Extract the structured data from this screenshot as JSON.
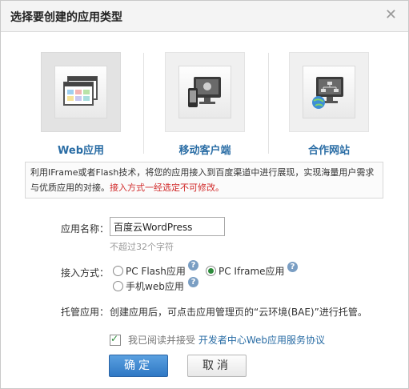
{
  "dialog": {
    "title": "选择要创建的应用类型",
    "close_glyph": "✕"
  },
  "types": [
    {
      "label": "Web应用",
      "icon": "browser-window-icon",
      "selected": true
    },
    {
      "label": "移动客户端",
      "icon": "mobile-device-icon",
      "selected": false
    },
    {
      "label": "合作网站",
      "icon": "network-site-icon",
      "selected": false
    }
  ],
  "info": {
    "text": "利用IFrame或者Flash技术，将您的应用接入到百度渠道中进行展现，实现海量用户需求与优质应用的对接。",
    "warning": "接入方式一经选定不可修改。"
  },
  "form": {
    "name_label": "应用名称：",
    "name_value": "百度云WordPress",
    "name_hint": "不超过32个字符",
    "access_label": "接入方式：",
    "access_options": [
      {
        "label": "PC Flash应用",
        "checked": false
      },
      {
        "label": "PC Iframe应用",
        "checked": true
      },
      {
        "label": "手机web应用",
        "checked": false
      }
    ],
    "hosting_label": "托管应用：",
    "hosting_text": "创建应用后，可点击应用管理页的“云环境(BAE)”进行托管。",
    "agree_prefix": "我已阅读并接受",
    "agree_link": "开发者中心Web应用服务协议",
    "agree_checked": true
  },
  "buttons": {
    "ok": "确定",
    "cancel": "取消"
  },
  "colors": {
    "accent": "#2a6da5",
    "warning": "#d12a2a",
    "primary_button": "#3a85cf"
  }
}
